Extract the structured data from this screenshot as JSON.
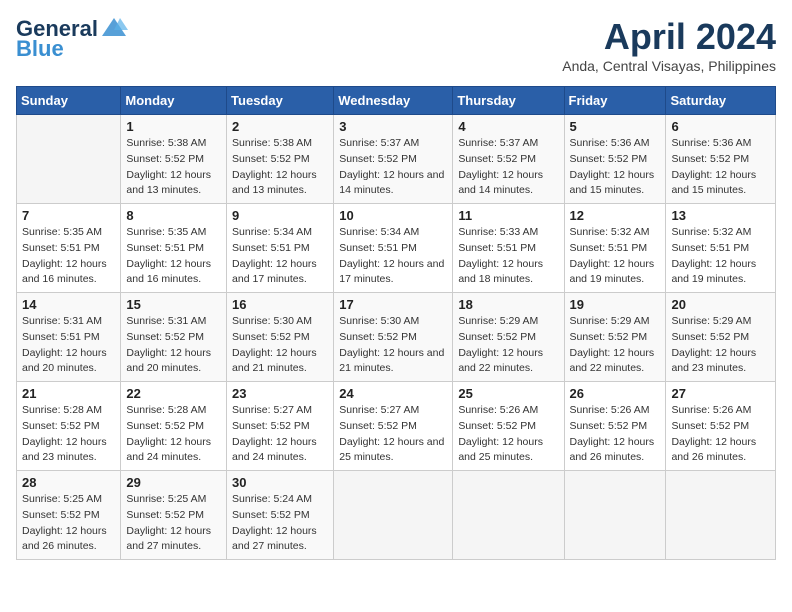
{
  "header": {
    "logo_general": "General",
    "logo_blue": "Blue",
    "month_title": "April 2024",
    "location": "Anda, Central Visayas, Philippines"
  },
  "days_of_week": [
    "Sunday",
    "Monday",
    "Tuesday",
    "Wednesday",
    "Thursday",
    "Friday",
    "Saturday"
  ],
  "weeks": [
    [
      {
        "day": "",
        "sunrise": "",
        "sunset": "",
        "daylight": ""
      },
      {
        "day": "1",
        "sunrise": "5:38 AM",
        "sunset": "5:52 PM",
        "daylight": "12 hours and 13 minutes."
      },
      {
        "day": "2",
        "sunrise": "5:38 AM",
        "sunset": "5:52 PM",
        "daylight": "12 hours and 13 minutes."
      },
      {
        "day": "3",
        "sunrise": "5:37 AM",
        "sunset": "5:52 PM",
        "daylight": "12 hours and 14 minutes."
      },
      {
        "day": "4",
        "sunrise": "5:37 AM",
        "sunset": "5:52 PM",
        "daylight": "12 hours and 14 minutes."
      },
      {
        "day": "5",
        "sunrise": "5:36 AM",
        "sunset": "5:52 PM",
        "daylight": "12 hours and 15 minutes."
      },
      {
        "day": "6",
        "sunrise": "5:36 AM",
        "sunset": "5:52 PM",
        "daylight": "12 hours and 15 minutes."
      }
    ],
    [
      {
        "day": "7",
        "sunrise": "5:35 AM",
        "sunset": "5:51 PM",
        "daylight": "12 hours and 16 minutes."
      },
      {
        "day": "8",
        "sunrise": "5:35 AM",
        "sunset": "5:51 PM",
        "daylight": "12 hours and 16 minutes."
      },
      {
        "day": "9",
        "sunrise": "5:34 AM",
        "sunset": "5:51 PM",
        "daylight": "12 hours and 17 minutes."
      },
      {
        "day": "10",
        "sunrise": "5:34 AM",
        "sunset": "5:51 PM",
        "daylight": "12 hours and 17 minutes."
      },
      {
        "day": "11",
        "sunrise": "5:33 AM",
        "sunset": "5:51 PM",
        "daylight": "12 hours and 18 minutes."
      },
      {
        "day": "12",
        "sunrise": "5:32 AM",
        "sunset": "5:51 PM",
        "daylight": "12 hours and 19 minutes."
      },
      {
        "day": "13",
        "sunrise": "5:32 AM",
        "sunset": "5:51 PM",
        "daylight": "12 hours and 19 minutes."
      }
    ],
    [
      {
        "day": "14",
        "sunrise": "5:31 AM",
        "sunset": "5:51 PM",
        "daylight": "12 hours and 20 minutes."
      },
      {
        "day": "15",
        "sunrise": "5:31 AM",
        "sunset": "5:52 PM",
        "daylight": "12 hours and 20 minutes."
      },
      {
        "day": "16",
        "sunrise": "5:30 AM",
        "sunset": "5:52 PM",
        "daylight": "12 hours and 21 minutes."
      },
      {
        "day": "17",
        "sunrise": "5:30 AM",
        "sunset": "5:52 PM",
        "daylight": "12 hours and 21 minutes."
      },
      {
        "day": "18",
        "sunrise": "5:29 AM",
        "sunset": "5:52 PM",
        "daylight": "12 hours and 22 minutes."
      },
      {
        "day": "19",
        "sunrise": "5:29 AM",
        "sunset": "5:52 PM",
        "daylight": "12 hours and 22 minutes."
      },
      {
        "day": "20",
        "sunrise": "5:29 AM",
        "sunset": "5:52 PM",
        "daylight": "12 hours and 23 minutes."
      }
    ],
    [
      {
        "day": "21",
        "sunrise": "5:28 AM",
        "sunset": "5:52 PM",
        "daylight": "12 hours and 23 minutes."
      },
      {
        "day": "22",
        "sunrise": "5:28 AM",
        "sunset": "5:52 PM",
        "daylight": "12 hours and 24 minutes."
      },
      {
        "day": "23",
        "sunrise": "5:27 AM",
        "sunset": "5:52 PM",
        "daylight": "12 hours and 24 minutes."
      },
      {
        "day": "24",
        "sunrise": "5:27 AM",
        "sunset": "5:52 PM",
        "daylight": "12 hours and 25 minutes."
      },
      {
        "day": "25",
        "sunrise": "5:26 AM",
        "sunset": "5:52 PM",
        "daylight": "12 hours and 25 minutes."
      },
      {
        "day": "26",
        "sunrise": "5:26 AM",
        "sunset": "5:52 PM",
        "daylight": "12 hours and 26 minutes."
      },
      {
        "day": "27",
        "sunrise": "5:26 AM",
        "sunset": "5:52 PM",
        "daylight": "12 hours and 26 minutes."
      }
    ],
    [
      {
        "day": "28",
        "sunrise": "5:25 AM",
        "sunset": "5:52 PM",
        "daylight": "12 hours and 26 minutes."
      },
      {
        "day": "29",
        "sunrise": "5:25 AM",
        "sunset": "5:52 PM",
        "daylight": "12 hours and 27 minutes."
      },
      {
        "day": "30",
        "sunrise": "5:24 AM",
        "sunset": "5:52 PM",
        "daylight": "12 hours and 27 minutes."
      },
      {
        "day": "",
        "sunrise": "",
        "sunset": "",
        "daylight": ""
      },
      {
        "day": "",
        "sunrise": "",
        "sunset": "",
        "daylight": ""
      },
      {
        "day": "",
        "sunrise": "",
        "sunset": "",
        "daylight": ""
      },
      {
        "day": "",
        "sunrise": "",
        "sunset": "",
        "daylight": ""
      }
    ]
  ],
  "labels": {
    "sunrise_prefix": "Sunrise: ",
    "sunset_prefix": "Sunset: ",
    "daylight_prefix": "Daylight: "
  }
}
